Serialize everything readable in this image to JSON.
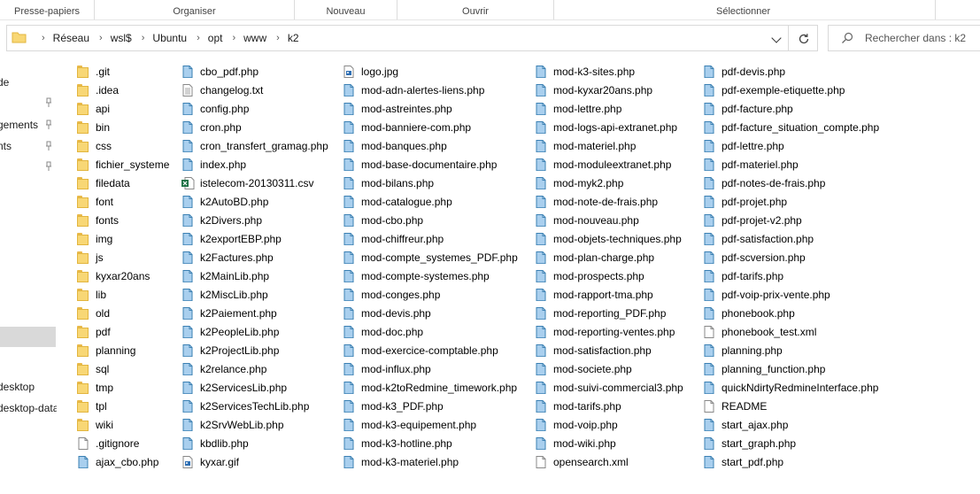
{
  "ribbon": {
    "groups": [
      "Presse-papiers",
      "Organiser",
      "Nouveau",
      "Ouvrir",
      "Sélectionner"
    ]
  },
  "address": {
    "crumbs": [
      "Réseau",
      "wsl$",
      "Ubuntu",
      "opt",
      "www",
      "k2"
    ]
  },
  "search": {
    "placeholder": "Rechercher dans : k2"
  },
  "nav": {
    "items": [
      "de",
      "gements",
      "nts",
      "desktop",
      "desktop-data"
    ]
  },
  "files": {
    "columns": [
      [
        {
          "name": ".git",
          "type": "folder"
        },
        {
          "name": ".idea",
          "type": "folder"
        },
        {
          "name": "api",
          "type": "folder"
        },
        {
          "name": "bin",
          "type": "folder"
        },
        {
          "name": "css",
          "type": "folder"
        },
        {
          "name": "fichier_systeme",
          "type": "folder"
        },
        {
          "name": "filedata",
          "type": "folder"
        },
        {
          "name": "font",
          "type": "folder"
        },
        {
          "name": "fonts",
          "type": "folder"
        },
        {
          "name": "img",
          "type": "folder"
        },
        {
          "name": "js",
          "type": "folder"
        },
        {
          "name": "kyxar20ans",
          "type": "folder"
        },
        {
          "name": "lib",
          "type": "folder"
        },
        {
          "name": "old",
          "type": "folder"
        },
        {
          "name": "pdf",
          "type": "folder"
        },
        {
          "name": "planning",
          "type": "folder"
        },
        {
          "name": "sql",
          "type": "folder"
        },
        {
          "name": "tmp",
          "type": "folder"
        },
        {
          "name": "tpl",
          "type": "folder"
        },
        {
          "name": "wiki",
          "type": "folder"
        },
        {
          "name": ".gitignore",
          "type": "blank"
        },
        {
          "name": "ajax_cbo.php",
          "type": "php"
        }
      ],
      [
        {
          "name": "cbo_pdf.php",
          "type": "php"
        },
        {
          "name": "changelog.txt",
          "type": "txt"
        },
        {
          "name": "config.php",
          "type": "php"
        },
        {
          "name": "cron.php",
          "type": "php"
        },
        {
          "name": "cron_transfert_gramag.php",
          "type": "php"
        },
        {
          "name": "index.php",
          "type": "php"
        },
        {
          "name": "istelecom-20130311.csv",
          "type": "csv"
        },
        {
          "name": "k2AutoBD.php",
          "type": "php"
        },
        {
          "name": "k2Divers.php",
          "type": "php"
        },
        {
          "name": "k2exportEBP.php",
          "type": "php"
        },
        {
          "name": "k2Factures.php",
          "type": "php"
        },
        {
          "name": "k2MainLib.php",
          "type": "php"
        },
        {
          "name": "k2MiscLib.php",
          "type": "php"
        },
        {
          "name": "k2Paiement.php",
          "type": "php"
        },
        {
          "name": "k2PeopleLib.php",
          "type": "php"
        },
        {
          "name": "k2ProjectLib.php",
          "type": "php"
        },
        {
          "name": "k2relance.php",
          "type": "php"
        },
        {
          "name": "k2ServicesLib.php",
          "type": "php"
        },
        {
          "name": "k2ServicesTechLib.php",
          "type": "php"
        },
        {
          "name": "k2SrvWebLib.php",
          "type": "php"
        },
        {
          "name": "kbdlib.php",
          "type": "php"
        },
        {
          "name": "kyxar.gif",
          "type": "image"
        }
      ],
      [
        {
          "name": "logo.jpg",
          "type": "image"
        },
        {
          "name": "mod-adn-alertes-liens.php",
          "type": "php"
        },
        {
          "name": "mod-astreintes.php",
          "type": "php"
        },
        {
          "name": "mod-banniere-com.php",
          "type": "php"
        },
        {
          "name": "mod-banques.php",
          "type": "php"
        },
        {
          "name": "mod-base-documentaire.php",
          "type": "php"
        },
        {
          "name": "mod-bilans.php",
          "type": "php"
        },
        {
          "name": "mod-catalogue.php",
          "type": "php"
        },
        {
          "name": "mod-cbo.php",
          "type": "php"
        },
        {
          "name": "mod-chiffreur.php",
          "type": "php"
        },
        {
          "name": "mod-compte_systemes_PDF.php",
          "type": "php"
        },
        {
          "name": "mod-compte-systemes.php",
          "type": "php"
        },
        {
          "name": "mod-conges.php",
          "type": "php"
        },
        {
          "name": "mod-devis.php",
          "type": "php"
        },
        {
          "name": "mod-doc.php",
          "type": "php"
        },
        {
          "name": "mod-exercice-comptable.php",
          "type": "php"
        },
        {
          "name": "mod-influx.php",
          "type": "php"
        },
        {
          "name": "mod-k2toRedmine_timework.php",
          "type": "php"
        },
        {
          "name": "mod-k3_PDF.php",
          "type": "php"
        },
        {
          "name": "mod-k3-equipement.php",
          "type": "php"
        },
        {
          "name": "mod-k3-hotline.php",
          "type": "php"
        },
        {
          "name": "mod-k3-materiel.php",
          "type": "php"
        }
      ],
      [
        {
          "name": "mod-k3-sites.php",
          "type": "php"
        },
        {
          "name": "mod-kyxar20ans.php",
          "type": "php"
        },
        {
          "name": "mod-lettre.php",
          "type": "php"
        },
        {
          "name": "mod-logs-api-extranet.php",
          "type": "php"
        },
        {
          "name": "mod-materiel.php",
          "type": "php"
        },
        {
          "name": "mod-moduleextranet.php",
          "type": "php"
        },
        {
          "name": "mod-myk2.php",
          "type": "php"
        },
        {
          "name": "mod-note-de-frais.php",
          "type": "php"
        },
        {
          "name": "mod-nouveau.php",
          "type": "php"
        },
        {
          "name": "mod-objets-techniques.php",
          "type": "php"
        },
        {
          "name": "mod-plan-charge.php",
          "type": "php"
        },
        {
          "name": "mod-prospects.php",
          "type": "php"
        },
        {
          "name": "mod-rapport-tma.php",
          "type": "php"
        },
        {
          "name": "mod-reporting_PDF.php",
          "type": "php"
        },
        {
          "name": "mod-reporting-ventes.php",
          "type": "php"
        },
        {
          "name": "mod-satisfaction.php",
          "type": "php"
        },
        {
          "name": "mod-societe.php",
          "type": "php"
        },
        {
          "name": "mod-suivi-commercial3.php",
          "type": "php"
        },
        {
          "name": "mod-tarifs.php",
          "type": "php"
        },
        {
          "name": "mod-voip.php",
          "type": "php"
        },
        {
          "name": "mod-wiki.php",
          "type": "php"
        },
        {
          "name": "opensearch.xml",
          "type": "blank"
        }
      ],
      [
        {
          "name": "pdf-devis.php",
          "type": "php"
        },
        {
          "name": "pdf-exemple-etiquette.php",
          "type": "php"
        },
        {
          "name": "pdf-facture.php",
          "type": "php"
        },
        {
          "name": "pdf-facture_situation_compte.php",
          "type": "php"
        },
        {
          "name": "pdf-lettre.php",
          "type": "php"
        },
        {
          "name": "pdf-materiel.php",
          "type": "php"
        },
        {
          "name": "pdf-notes-de-frais.php",
          "type": "php"
        },
        {
          "name": "pdf-projet.php",
          "type": "php"
        },
        {
          "name": "pdf-projet-v2.php",
          "type": "php"
        },
        {
          "name": "pdf-satisfaction.php",
          "type": "php"
        },
        {
          "name": "pdf-scversion.php",
          "type": "php"
        },
        {
          "name": "pdf-tarifs.php",
          "type": "php"
        },
        {
          "name": "pdf-voip-prix-vente.php",
          "type": "php"
        },
        {
          "name": "phonebook.php",
          "type": "php"
        },
        {
          "name": "phonebook_test.xml",
          "type": "blank"
        },
        {
          "name": "planning.php",
          "type": "php"
        },
        {
          "name": "planning_function.php",
          "type": "php"
        },
        {
          "name": "quickNdirtyRedmineInterface.php",
          "type": "php"
        },
        {
          "name": "README",
          "type": "blank"
        },
        {
          "name": "start_ajax.php",
          "type": "php"
        },
        {
          "name": "start_graph.php",
          "type": "php"
        },
        {
          "name": "start_pdf.php",
          "type": "php"
        }
      ]
    ]
  }
}
